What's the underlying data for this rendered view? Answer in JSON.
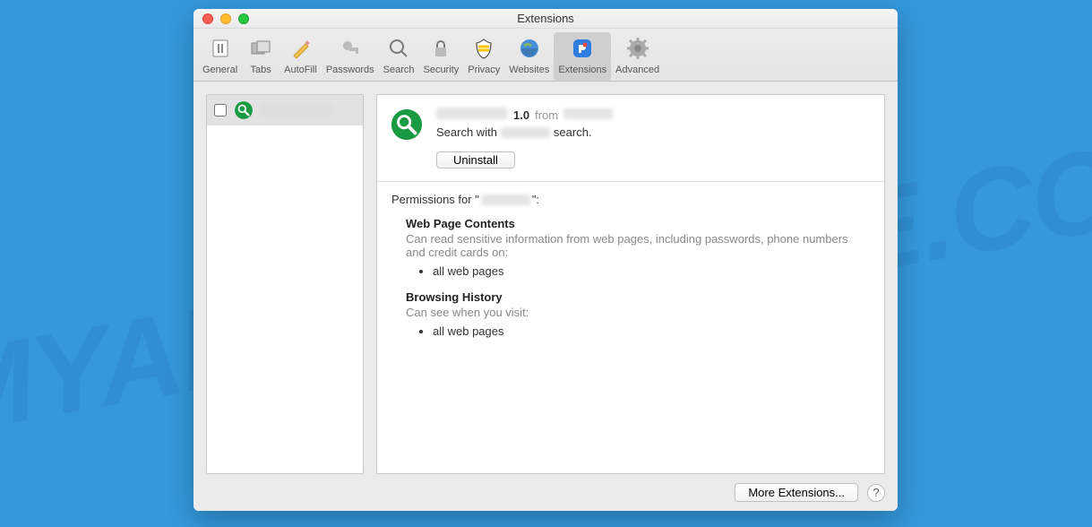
{
  "watermark": "MYANTISPYWARE.COM",
  "window": {
    "title": "Extensions"
  },
  "toolbar": {
    "items": [
      {
        "label": "General"
      },
      {
        "label": "Tabs"
      },
      {
        "label": "AutoFill"
      },
      {
        "label": "Passwords"
      },
      {
        "label": "Search"
      },
      {
        "label": "Security"
      },
      {
        "label": "Privacy"
      },
      {
        "label": "Websites"
      },
      {
        "label": "Extensions"
      },
      {
        "label": "Advanced"
      }
    ]
  },
  "sidebar": {
    "item": {
      "checked": false
    }
  },
  "detail": {
    "version": "1.0",
    "from": "from",
    "desc_prefix": "Search with",
    "desc_suffix": "search.",
    "uninstall": "Uninstall"
  },
  "permissions": {
    "title_prefix": "Permissions for \"",
    "title_suffix": "\":",
    "sections": [
      {
        "head": "Web Page Contents",
        "desc": "Can read sensitive information from web pages, including passwords, phone numbers and credit cards on:",
        "items": [
          "all web pages"
        ]
      },
      {
        "head": "Browsing History",
        "desc": "Can see when you visit:",
        "items": [
          "all web pages"
        ]
      }
    ]
  },
  "footer": {
    "more": "More Extensions...",
    "help": "?"
  }
}
